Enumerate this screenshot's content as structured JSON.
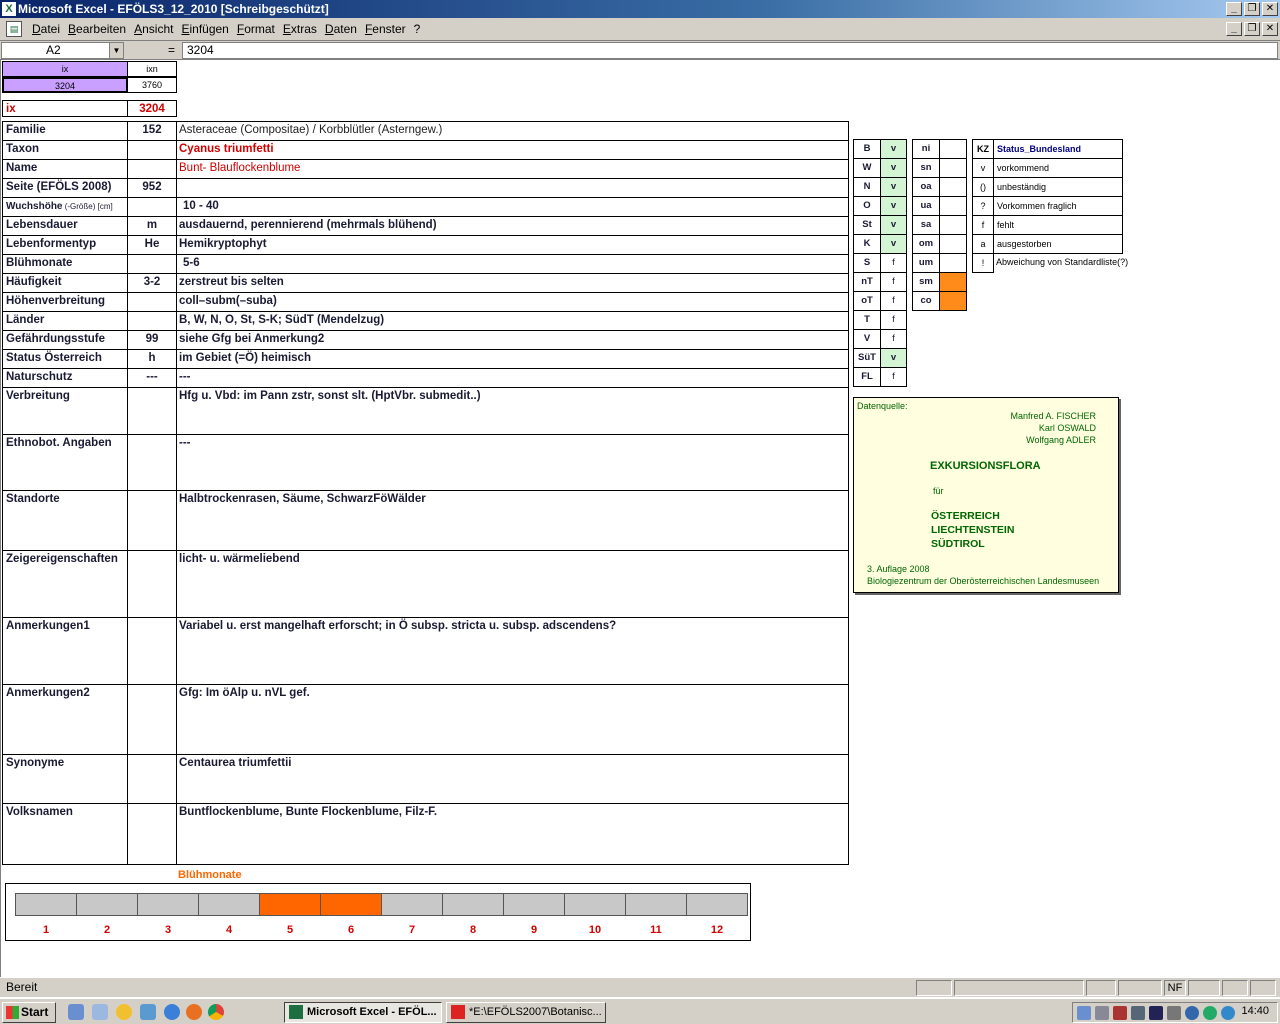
{
  "window": {
    "title": "Microsoft Excel - EFÖLS3_12_2010  [Schreibgeschützt]"
  },
  "menu": [
    "Datei",
    "Bearbeiten",
    "Ansicht",
    "Einfügen",
    "Format",
    "Extras",
    "Daten",
    "Fenster",
    "?"
  ],
  "formula": {
    "namebox": "A2",
    "eq": "=",
    "value": "3204"
  },
  "top": {
    "ix_label": "ix",
    "ixn_label": "ixn",
    "ix_value": "3204",
    "ixn_value": "3760",
    "ix_row_label": "ix",
    "ix_row_value": "3204"
  },
  "rows": [
    {
      "label": "Familie",
      "mid": "152",
      "value": "Asteraceae (Compositae)  /  Korbblütler (Asterngew.)"
    },
    {
      "label": "Taxon",
      "mid": "",
      "value": "Cyanus triumfetti"
    },
    {
      "label": "Name",
      "mid": "",
      "value": "Bunt- Blauflockenblume"
    },
    {
      "label": "Seite (EFÖLS 2008)",
      "mid": "952",
      "value": ""
    },
    {
      "label": "Wuchshöhe",
      "label_small": " (-Größe) [cm]",
      "mid": "",
      "value": "10 - 40"
    },
    {
      "label": "Lebensdauer",
      "mid": "m",
      "value": "ausdauernd, perennierend (mehrmals blühend)"
    },
    {
      "label": "Lebenformentyp",
      "mid": "He",
      "value": "Hemikryptophyt"
    },
    {
      "label": "Blühmonate",
      "mid": "",
      "value": "5-6"
    },
    {
      "label": "Häufigkeit",
      "mid": "3-2",
      "value": "zerstreut bis selten"
    },
    {
      "label": "Höhenverbreitung",
      "mid": "",
      "value": "coll–subm(–suba)"
    },
    {
      "label": "Länder",
      "mid": "",
      "value": "B, W, N, O, St, S-K; SüdT (Mendelzug)"
    },
    {
      "label": "Gefährdungsstufe",
      "mid": "99",
      "value": "siehe Gfg bei Anmerkung2"
    },
    {
      "label": "Status Österreich",
      "mid": "h",
      "value": "im Gebiet (=Ö) heimisch"
    },
    {
      "label": "Naturschutz",
      "mid": "---",
      "value": "---"
    },
    {
      "label": "Verbreitung",
      "mid": "",
      "value": "Hfg u. Vbd: im Pann zstr, sonst slt. (HptVbr. submedit..)"
    },
    {
      "label": "Ethnobot. Angaben",
      "mid": "",
      "value": "---"
    },
    {
      "label": "Standorte",
      "mid": "",
      "value": "Halbtrockenrasen, Säume, SchwarzFöWälder"
    },
    {
      "label": "Zeigereigenschaften",
      "mid": "",
      "value": "licht- u. wärmeliebend"
    },
    {
      "label": "Anmerkungen1",
      "mid": "",
      "value": "Variabel u. erst mangelhaft erforscht; in Ö subsp. stricta u. subsp. adscendens?"
    },
    {
      "label": "Anmerkungen2",
      "mid": "",
      "value": "Gfg: Im öAlp u. nVL gef."
    },
    {
      "label": "Synonyme",
      "mid": "",
      "value": "Centaurea triumfettii"
    },
    {
      "label": "Volksnamen",
      "mid": "",
      "value": "Buntflockenblume, Bunte Flockenblume, Filz-F."
    }
  ],
  "states": [
    {
      "code": "B",
      "val": "v"
    },
    {
      "code": "W",
      "val": "v"
    },
    {
      "code": "N",
      "val": "v"
    },
    {
      "code": "O",
      "val": "v"
    },
    {
      "code": "St",
      "val": "v"
    },
    {
      "code": "K",
      "val": "v"
    },
    {
      "code": "S",
      "val": "f"
    },
    {
      "code": "nT",
      "val": "f"
    },
    {
      "code": "oT",
      "val": "f"
    },
    {
      "code": "T",
      "val": "f"
    },
    {
      "code": "V",
      "val": "f"
    },
    {
      "code": "SüT",
      "val": "v"
    },
    {
      "code": "FL",
      "val": "f"
    }
  ],
  "altitudes": [
    "ni",
    "sn",
    "oa",
    "ua",
    "sa",
    "om",
    "um",
    "sm",
    "co"
  ],
  "legend": {
    "kz": "KZ",
    "title": "Status_Bundesland",
    "items": [
      {
        "k": "v",
        "t": "vorkommend"
      },
      {
        "k": "()",
        "t": "unbeständig"
      },
      {
        "k": "?",
        "t": "Vorkommen fraglich"
      },
      {
        "k": "f",
        "t": "fehlt"
      },
      {
        "k": "a",
        "t": "ausgestorben"
      },
      {
        "k": "!",
        "t": "Abweichung von Standardliste(?)"
      }
    ]
  },
  "datenquelle": {
    "label": "Datenquelle:",
    "authors": [
      "Manfred A. FISCHER",
      "Karl OSWALD",
      "Wolfgang ADLER"
    ],
    "title": "EXKURSIONSFLORA",
    "fuer": "für",
    "countries": [
      "ÖSTERREICH",
      "LIECHTENSTEIN",
      "SÜDTIROL"
    ],
    "edition": "3. Auflage 2008",
    "publisher": "Biologiezentrum der Oberösterreichischen Landesmuseen"
  },
  "bluehmonate": {
    "label": "Blühmonate",
    "months": [
      "1",
      "2",
      "3",
      "4",
      "5",
      "6",
      "7",
      "8",
      "9",
      "10",
      "11",
      "12"
    ],
    "active": [
      5,
      6
    ],
    "active_color": "#ff6600"
  },
  "status": {
    "text": "Bereit",
    "nf": "NF"
  },
  "taskbar": {
    "start": "Start",
    "tasks": [
      "Microsoft Excel - EFÖL...",
      "*E:\\EFÖLS2007\\Botanisc..."
    ],
    "clock": "14:40"
  }
}
